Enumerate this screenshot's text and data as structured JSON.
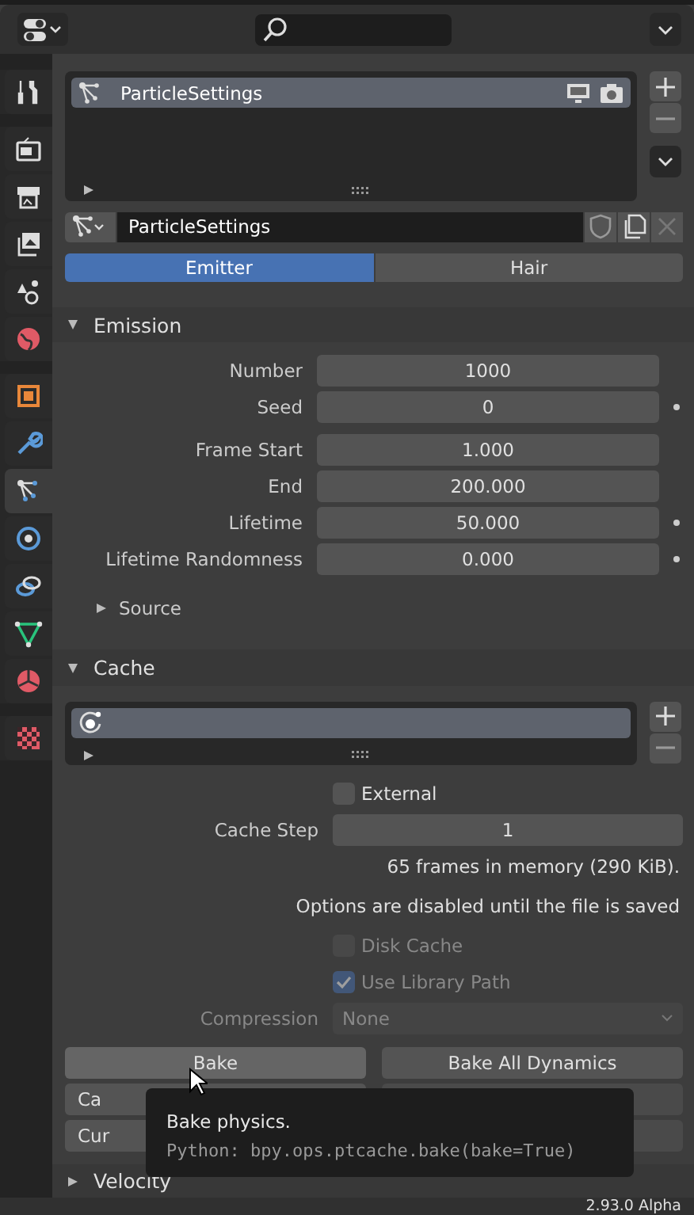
{
  "sidebar": {
    "groups": [
      [
        {
          "kind": "tool",
          "selected": false
        }
      ],
      [
        {
          "kind": "render",
          "selected": false
        },
        {
          "kind": "output",
          "selected": false
        },
        {
          "kind": "view_layer",
          "selected": false
        },
        {
          "kind": "scene",
          "selected": false
        },
        {
          "kind": "world",
          "selected": false
        }
      ],
      [
        {
          "kind": "object",
          "selected": false
        },
        {
          "kind": "modifier",
          "selected": false
        },
        {
          "kind": "particles",
          "selected": true
        },
        {
          "kind": "physics",
          "selected": false
        },
        {
          "kind": "constraints",
          "selected": false
        },
        {
          "kind": "data",
          "selected": false
        },
        {
          "kind": "material",
          "selected": false
        }
      ],
      [
        {
          "kind": "texture",
          "selected": false
        }
      ]
    ]
  },
  "particle_list": {
    "items": [
      {
        "name": "ParticleSettings",
        "selected": true
      }
    ]
  },
  "datablock": {
    "name": "ParticleSettings"
  },
  "tabs": [
    {
      "label": "Emitter",
      "selected": true
    },
    {
      "label": "Hair",
      "selected": false
    }
  ],
  "emission": {
    "title": "Emission",
    "expanded": true,
    "field_groups": [
      [
        {
          "label": "Number",
          "value": "1000",
          "animatable": false
        },
        {
          "label": "Seed",
          "value": "0",
          "animatable": true
        }
      ],
      [
        {
          "label": "Frame Start",
          "value": "1.000",
          "animatable": false
        },
        {
          "label": "End",
          "value": "200.000",
          "animatable": false
        },
        {
          "label": "Lifetime",
          "value": "50.000",
          "animatable": true
        },
        {
          "label": "Lifetime Randomness",
          "value": "0.000",
          "animatable": true
        }
      ]
    ],
    "subpanel": {
      "title": "Source",
      "expanded": false
    }
  },
  "cache": {
    "title": "Cache",
    "expanded": true,
    "external": {
      "label": "External",
      "checked": false,
      "disabled": false
    },
    "cache_step": {
      "label": "Cache Step",
      "value": "1"
    },
    "info": [
      "65 frames in memory (290 KiB).",
      "Options are disabled until the file is saved"
    ],
    "disk_cache": {
      "label": "Disk Cache",
      "checked": false,
      "disabled": true
    },
    "use_library_path": {
      "label": "Use Library Path",
      "checked": true,
      "disabled": true
    },
    "compression": {
      "label": "Compression",
      "value": "None",
      "disabled": true
    },
    "buttons": [
      {
        "label": "Bake",
        "disabled": false
      },
      {
        "label": "Bake All Dynamics",
        "disabled": false
      },
      {
        "label": "Ca",
        "disabled": false
      },
      {
        "disabled": true
      },
      {
        "label": "Cur",
        "disabled": false
      },
      {
        "disabled": true
      }
    ]
  },
  "velocity": {
    "title": "Velocity",
    "expanded": false
  },
  "tooltip": {
    "title": "Bake physics.",
    "python": "Python: bpy.ops.ptcache.bake(bake=True)"
  },
  "status_bar": {
    "version": "2.93.0 Alpha"
  }
}
